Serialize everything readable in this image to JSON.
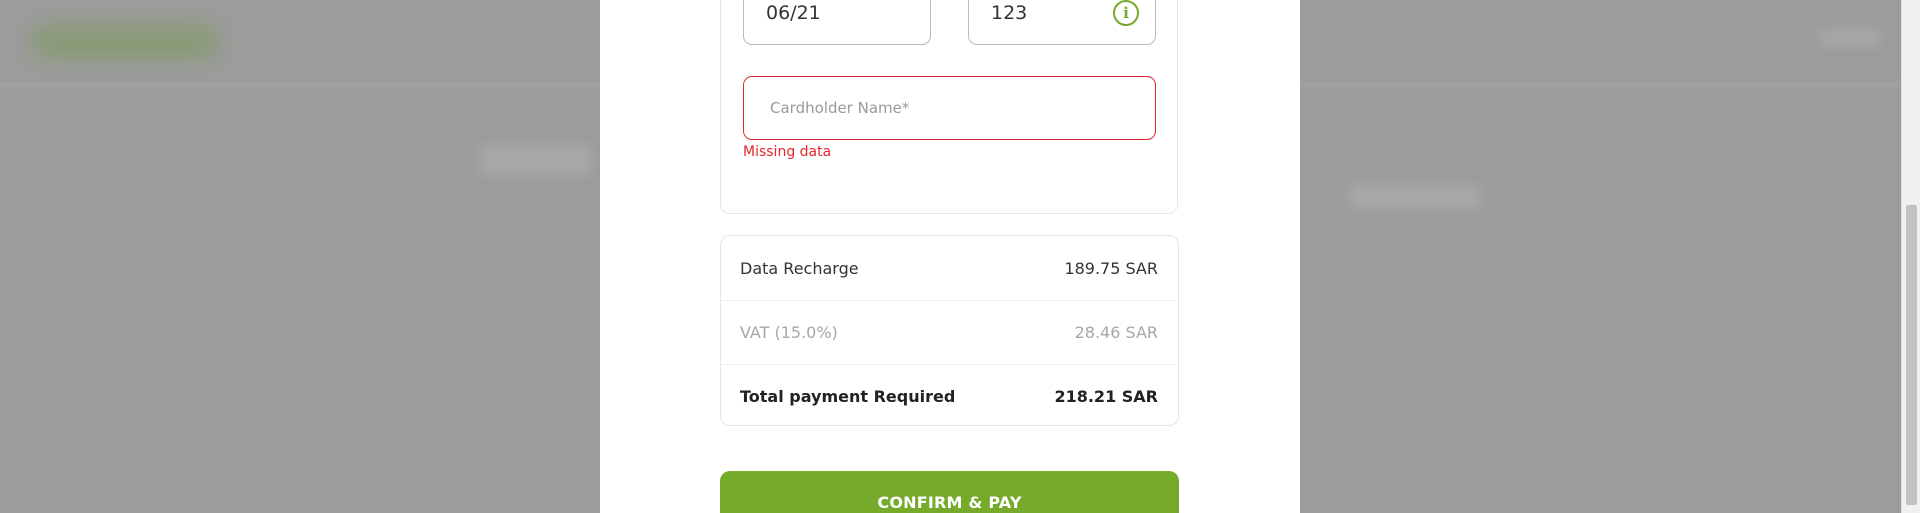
{
  "card_form": {
    "expiry_value": "06/21",
    "cvv_value": "123",
    "cvv_info_glyph": "i",
    "cardholder_placeholder": "Cardholder Name*",
    "cardholder_error": "Missing data"
  },
  "summary": {
    "rows": [
      {
        "label": "Data Recharge",
        "amount": "189.75 SAR"
      },
      {
        "label": "VAT (15.0%)",
        "amount": "28.46 SAR"
      },
      {
        "label": "Total payment Required",
        "amount": "218.21 SAR"
      }
    ]
  },
  "actions": {
    "confirm_label": "CONFIRM & PAY"
  },
  "colors": {
    "accent": "#75aa2b",
    "error": "#e5272d",
    "overlay": "#9a9a9a"
  }
}
